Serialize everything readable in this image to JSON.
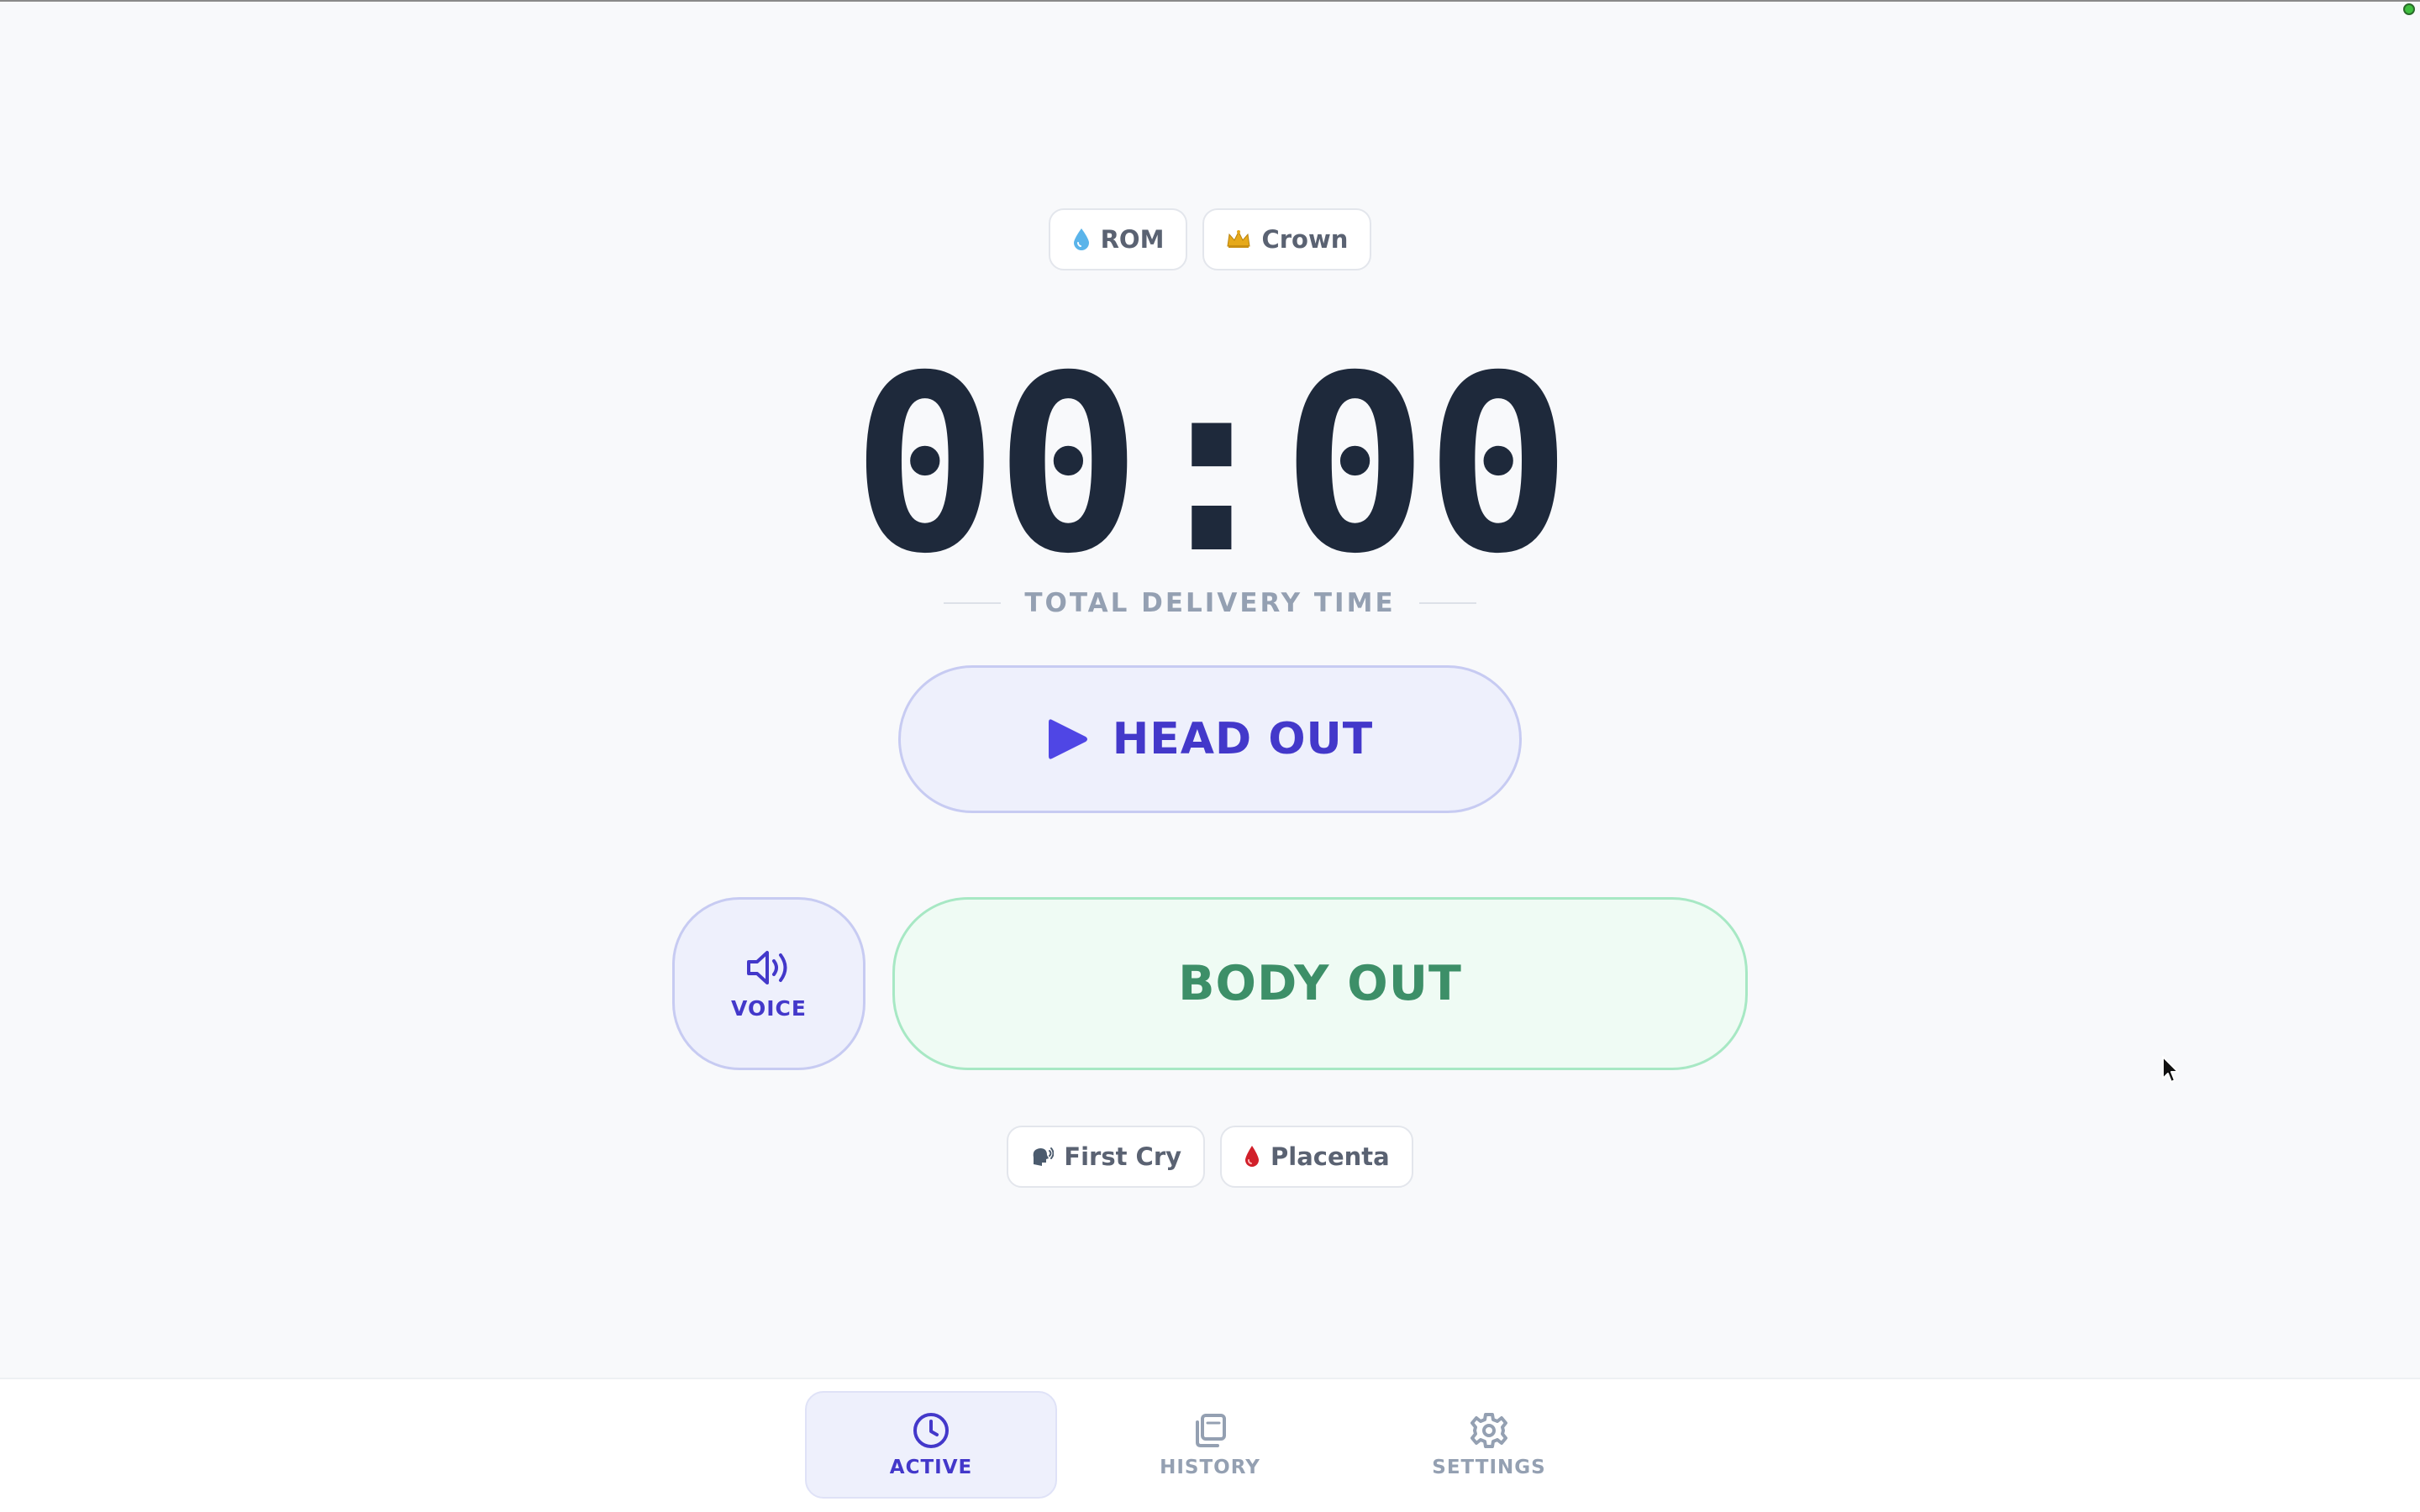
{
  "top_chips": [
    {
      "label": "ROM",
      "icon": "droplet-icon",
      "icon_glyph": "💧"
    },
    {
      "label": "Crown",
      "icon": "crown-icon",
      "icon_glyph": "👑"
    }
  ],
  "timer": {
    "display": "00:00",
    "caption": "TOTAL DELIVERY TIME"
  },
  "head_out": {
    "label": "HEAD OUT",
    "icon": "play-icon"
  },
  "voice": {
    "label": "VOICE",
    "icon": "speaker-icon"
  },
  "body_out": {
    "label": "BODY OUT"
  },
  "bottom_chips": [
    {
      "label": "First Cry",
      "icon": "speaking-head-icon",
      "icon_glyph": "🗣"
    },
    {
      "label": "Placenta",
      "icon": "blood-drop-icon",
      "icon_glyph": "🩸"
    }
  ],
  "nav": {
    "items": [
      {
        "label": "ACTIVE",
        "icon": "clock-icon",
        "active": true
      },
      {
        "label": "HISTORY",
        "icon": "history-icon",
        "active": false
      },
      {
        "label": "SETTINGS",
        "icon": "gear-icon",
        "active": false
      }
    ]
  },
  "colors": {
    "background": "#f8f9fb",
    "indigo_accent": "#4338ca",
    "green_accent": "#3d8f68",
    "timer_text": "#1e293b",
    "muted_text": "#94a0b2"
  }
}
